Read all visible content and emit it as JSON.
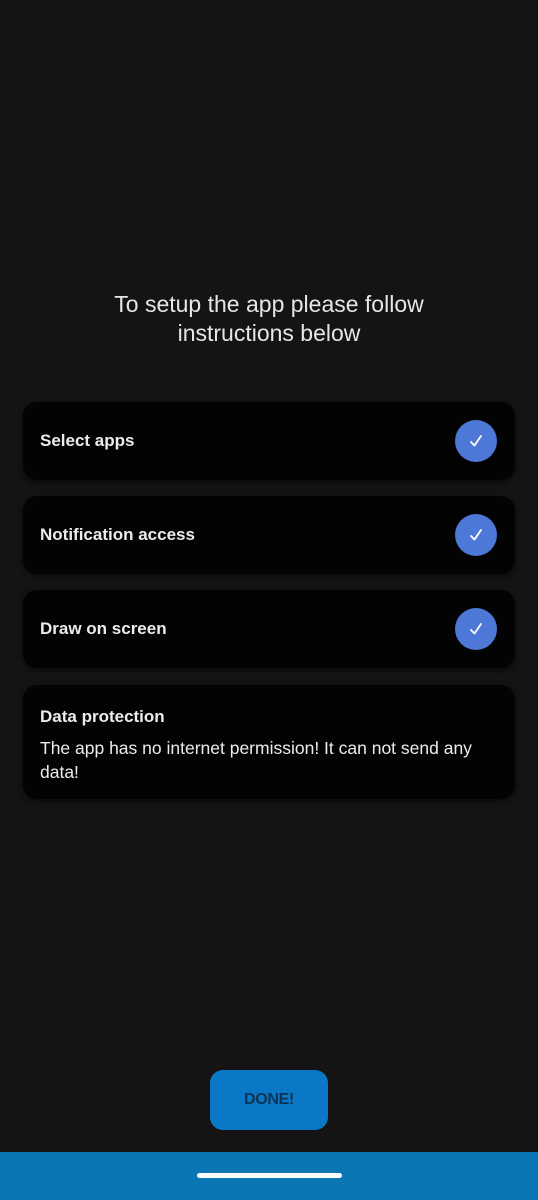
{
  "header": {
    "instruction_line1": "To setup the app please follow",
    "instruction_line2": "instructions below"
  },
  "steps": [
    {
      "label": "Select apps",
      "completed": true,
      "icon": "check-icon"
    },
    {
      "label": "Notification access",
      "completed": true,
      "icon": "check-icon"
    },
    {
      "label": "Draw on screen",
      "completed": true,
      "icon": "check-icon"
    }
  ],
  "info_card": {
    "title": "Data protection",
    "text": "The app has no internet permission! It can not send any data!"
  },
  "done_button": {
    "label": "DONE!"
  },
  "colors": {
    "background": "#141414",
    "card": "#030303",
    "check_accent": "#4d78d8",
    "button": "#0a78c6",
    "nav_bar": "#0a76b4"
  }
}
